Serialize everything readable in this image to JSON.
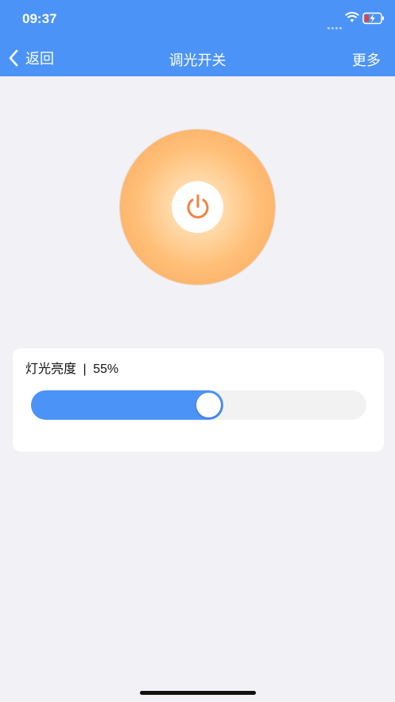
{
  "status_bar": {
    "time": "09:37"
  },
  "navbar": {
    "back_label": "返回",
    "title": "调光开关",
    "more_label": "更多"
  },
  "power": {
    "icon": "power-icon"
  },
  "brightness": {
    "label": "灯光亮度",
    "separator": "|",
    "value_text": "55%",
    "value": 0.55
  },
  "colors": {
    "accent": "#4b93f6",
    "power_icon": "#f2823f",
    "background": "#f2f1f6"
  }
}
